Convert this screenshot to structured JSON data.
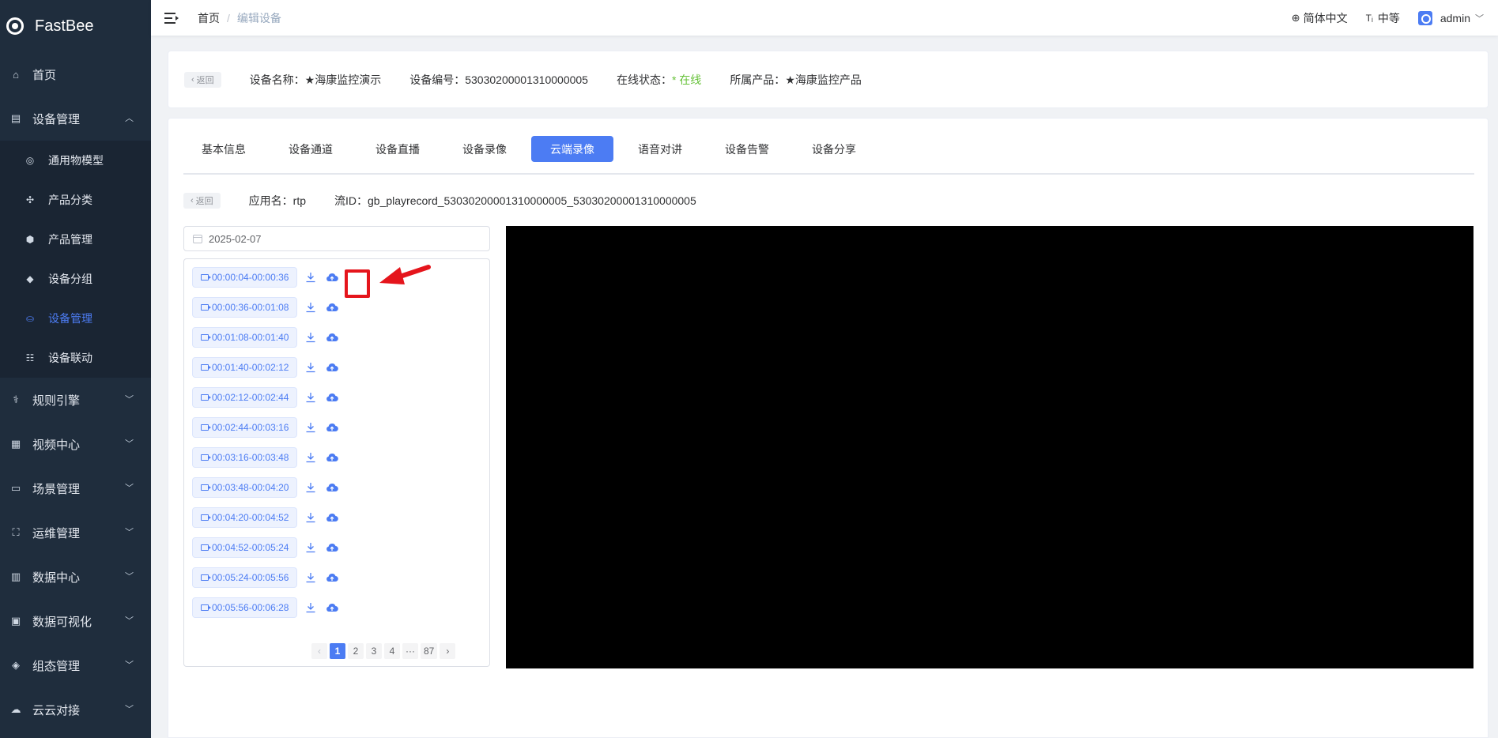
{
  "app": {
    "name": "FastBee"
  },
  "sidebar": {
    "items": [
      {
        "label": "首页",
        "icon": "home-icon",
        "glyph": "⌂",
        "arrow": ""
      },
      {
        "label": "设备管理",
        "icon": "server-icon",
        "glyph": "▤",
        "arrow": "︿"
      },
      {
        "label": "规则引擎",
        "icon": "network-icon",
        "glyph": "⚕",
        "arrow": "﹀"
      },
      {
        "label": "视频中心",
        "icon": "grid-icon",
        "glyph": "▦",
        "arrow": "﹀"
      },
      {
        "label": "场景管理",
        "icon": "monitor-icon",
        "glyph": "▭",
        "arrow": "﹀"
      },
      {
        "label": "运维管理",
        "icon": "tree-icon",
        "glyph": "⛶",
        "arrow": "﹀"
      },
      {
        "label": "数据中心",
        "icon": "bar-chart-icon",
        "glyph": "▥",
        "arrow": "﹀"
      },
      {
        "label": "数据可视化",
        "icon": "screen-icon",
        "glyph": "▣",
        "arrow": "﹀"
      },
      {
        "label": "组态管理",
        "icon": "layers-icon",
        "glyph": "◈",
        "arrow": "﹀"
      },
      {
        "label": "云云对接",
        "icon": "cloud-icon",
        "glyph": "☁",
        "arrow": "﹀"
      }
    ],
    "sub_items": [
      {
        "label": "通用物模型",
        "icon": "model-icon",
        "glyph": "◎"
      },
      {
        "label": "产品分类",
        "icon": "category-icon",
        "glyph": "✣"
      },
      {
        "label": "产品管理",
        "icon": "cube-icon",
        "glyph": "⬢"
      },
      {
        "label": "设备分组",
        "icon": "group-icon",
        "glyph": "◆"
      },
      {
        "label": "设备管理",
        "icon": "device-icon",
        "glyph": "⛀"
      },
      {
        "label": "设备联动",
        "icon": "linkage-icon",
        "glyph": "☷"
      }
    ]
  },
  "header": {
    "breadcrumb": {
      "home": "首页",
      "separator": "/",
      "current": "编辑设备"
    },
    "language": "简体中文",
    "font_size": "中等",
    "user": "admin"
  },
  "device": {
    "back_label": "返回",
    "name_label": "设备名称：",
    "name": "★海康监控演示",
    "code_label": "设备编号：",
    "code": "53030200001310000005",
    "status_label": "在线状态：",
    "status": "* 在线",
    "product_label": "所属产品：",
    "product": "★海康监控产品"
  },
  "tabs": [
    "基本信息",
    "设备通道",
    "设备直播",
    "设备录像",
    "云端录像",
    "语音对讲",
    "设备告警",
    "设备分享"
  ],
  "active_tab": "云端录像",
  "stream": {
    "back_label": "返回",
    "app_label": "应用名：",
    "app": "rtp",
    "stream_label": "流ID：",
    "stream_id": "gb_playrecord_53030200001310000005_53030200001310000005"
  },
  "date": "2025-02-07",
  "records": [
    "00:00:04-00:00:36",
    "00:00:36-00:01:08",
    "00:01:08-00:01:40",
    "00:01:40-00:02:12",
    "00:02:12-00:02:44",
    "00:02:44-00:03:16",
    "00:03:16-00:03:48",
    "00:03:48-00:04:20",
    "00:04:20-00:04:52",
    "00:04:52-00:05:24",
    "00:05:24-00:05:56",
    "00:05:56-00:06:28"
  ],
  "pagination": {
    "prev": "‹",
    "pages": [
      "1",
      "2",
      "3",
      "4",
      "···",
      "87"
    ],
    "current": "1",
    "next": "›"
  },
  "colors": {
    "accent": "#4c7cf3",
    "sidebar_bg": "#1f2d3d",
    "online": "#67c23a",
    "highlight": "#e5151c"
  }
}
